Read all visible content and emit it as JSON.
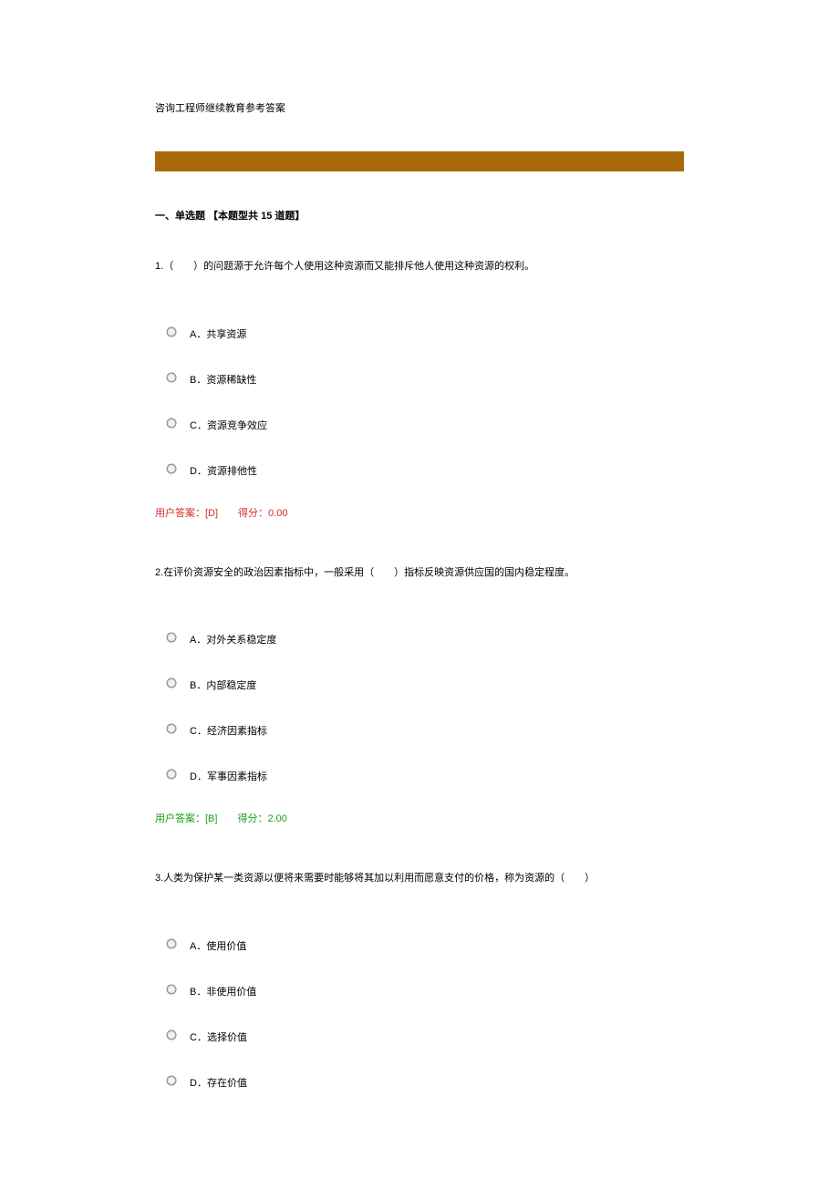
{
  "title": "咨询工程师继续教育参考答案",
  "section_header": "一、单选题 【本题型共 15 道题】",
  "questions": [
    {
      "number": "1.",
      "text": "（　　）的问题源于允许每个人使用这种资源而又能排斥他人使用这种资源的权利。",
      "options": {
        "a": "A．共享资源",
        "b": "B．资源稀缺性",
        "c": "C．资源竞争效应",
        "d": "D．资源排他性"
      },
      "answer": "用户答案：[D]　　得分：0.00",
      "correct": false
    },
    {
      "number": "2.",
      "text": "在评价资源安全的政治因素指标中，一般采用（　　）指标反映资源供应国的国内稳定程度。",
      "options": {
        "a": "A．对外关系稳定度",
        "b": "B．内部稳定度",
        "c": "C．经济因素指标",
        "d": "D．军事因素指标"
      },
      "answer": "用户答案：[B]　　得分：2.00",
      "correct": true
    },
    {
      "number": "3.",
      "text": "人类为保护某一类资源以便将来需要时能够将其加以利用而愿意支付的价格，称为资源的（　　）",
      "options": {
        "a": "A．使用价值",
        "b": "B．非使用价值",
        "c": "C．选择价值",
        "d": "D．存在价值"
      },
      "answer": "",
      "correct": null
    }
  ]
}
